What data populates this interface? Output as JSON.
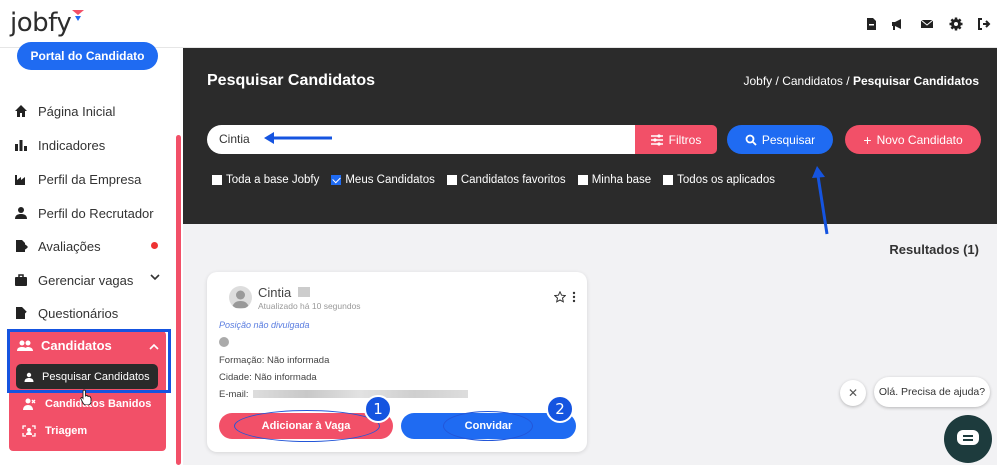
{
  "app": {
    "logo": "jobfy"
  },
  "topbar": {
    "icons": [
      "document-icon",
      "megaphone-icon",
      "mail-icon",
      "gear-icon",
      "logout-icon"
    ]
  },
  "sidebar": {
    "portal_button": "Portal do Candidato",
    "items": [
      {
        "label": "Página Inicial",
        "icon": "home-icon"
      },
      {
        "label": "Indicadores",
        "icon": "bar-chart-icon"
      },
      {
        "label": "Perfil da Empresa",
        "icon": "industry-icon"
      },
      {
        "label": "Perfil do Recrutador",
        "icon": "user-icon"
      },
      {
        "label": "Avaliações",
        "icon": "file-export-icon"
      },
      {
        "label": "Gerenciar vagas",
        "icon": "briefcase-icon"
      },
      {
        "label": "Questionários",
        "icon": "file-edit-icon"
      }
    ],
    "candidatos": {
      "label": "Candidatos",
      "sub": [
        "Pesquisar Candidatos",
        "Candidatos Banidos",
        "Triagem"
      ]
    }
  },
  "header": {
    "title": "Pesquisar Candidatos",
    "breadcrumb": [
      "Jobfy",
      "/",
      "Candidatos",
      "/",
      "Pesquisar Candidatos"
    ]
  },
  "search": {
    "value": "Cintia",
    "filtros_label": "Filtros",
    "search_label": "Pesquisar",
    "new_label": "Novo Candidato"
  },
  "filters": [
    {
      "label": "Toda a base Jobfy",
      "checked": false
    },
    {
      "label": "Meus Candidatos",
      "checked": true
    },
    {
      "label": "Candidatos favoritos",
      "checked": false
    },
    {
      "label": "Minha base",
      "checked": false
    },
    {
      "label": "Todos os aplicados",
      "checked": false
    }
  ],
  "results": {
    "label": "Resultados (1)"
  },
  "card": {
    "name": "Cintia",
    "updated": "Atualizado há 10 segundos",
    "position": "Posição não divulgada",
    "formacao": "Formação: Não informada",
    "cidade": "Cidade: Não informada",
    "email_label": "E-mail:",
    "add_button": "Adicionar à Vaga",
    "invite_button": "Convidar"
  },
  "annotations": {
    "badge1": "1",
    "badge2": "2"
  },
  "chat": {
    "message": "Olá. Precisa de ajuda?",
    "close": "✕"
  },
  "colors": {
    "primary_blue": "#1f6bf2",
    "accent_red": "#f25068",
    "dark_header": "#2b2b2b"
  }
}
